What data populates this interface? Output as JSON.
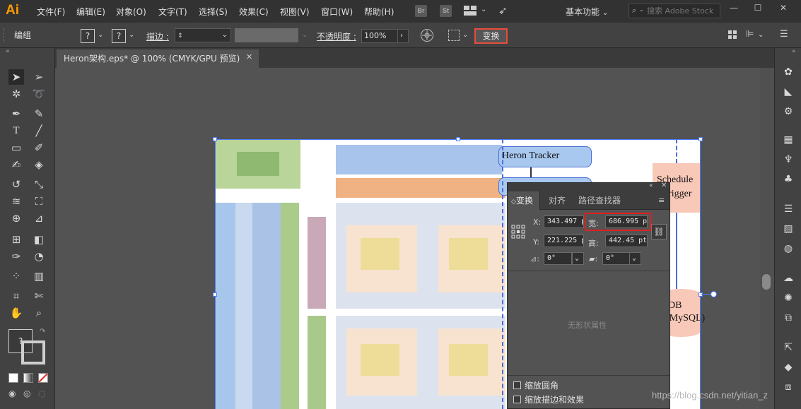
{
  "app": {
    "logo": "Ai"
  },
  "menu": [
    "文件(F)",
    "编辑(E)",
    "对象(O)",
    "文字(T)",
    "选择(S)",
    "效果(C)",
    "视图(V)",
    "窗口(W)",
    "帮助(H)"
  ],
  "menubar_icons": {
    "bridge": "Br",
    "stock": "St"
  },
  "workspace": "基本功能",
  "search": {
    "placeholder": "搜索 Adobe Stock"
  },
  "window_controls": {
    "minimize": "—",
    "maximize": "☐",
    "close": "✕"
  },
  "control_bar": {
    "mode": "编组",
    "fill_value": "?",
    "stroke_value": "?",
    "stroke_label": "描边 :",
    "opacity_label": "不透明度 :",
    "opacity_value": "100%",
    "transform_button": "变换"
  },
  "document_tab": {
    "title": "Heron架构.eps* @ 100% (CMYK/GPU 预览)",
    "close": "✕"
  },
  "tools": {
    "fill_stroke": "?"
  },
  "artboard_text": {
    "tracker": "Heron Tracker",
    "schedule_1": "Schedule",
    "schedule_2": "Trigger",
    "db_1": "DB",
    "db_2": "(MySQL)"
  },
  "transform_panel": {
    "tabs": [
      "变换",
      "对齐",
      "路径查找器"
    ],
    "x_label": "X:",
    "x_value": "343.497 p",
    "y_label": "Y:",
    "y_value": "221.225 p",
    "width_label": "宽:",
    "width_value": "686.995 p",
    "height_label": "高:",
    "height_value": "442.45 pt",
    "rotate_value": "0°",
    "shear_value": "0°",
    "no_shape": "无形状属性",
    "scale_corners": "缩放圆角",
    "scale_strokes": "缩放描边和效果"
  },
  "watermark": "https://blog.csdn.net/yitian_z"
}
